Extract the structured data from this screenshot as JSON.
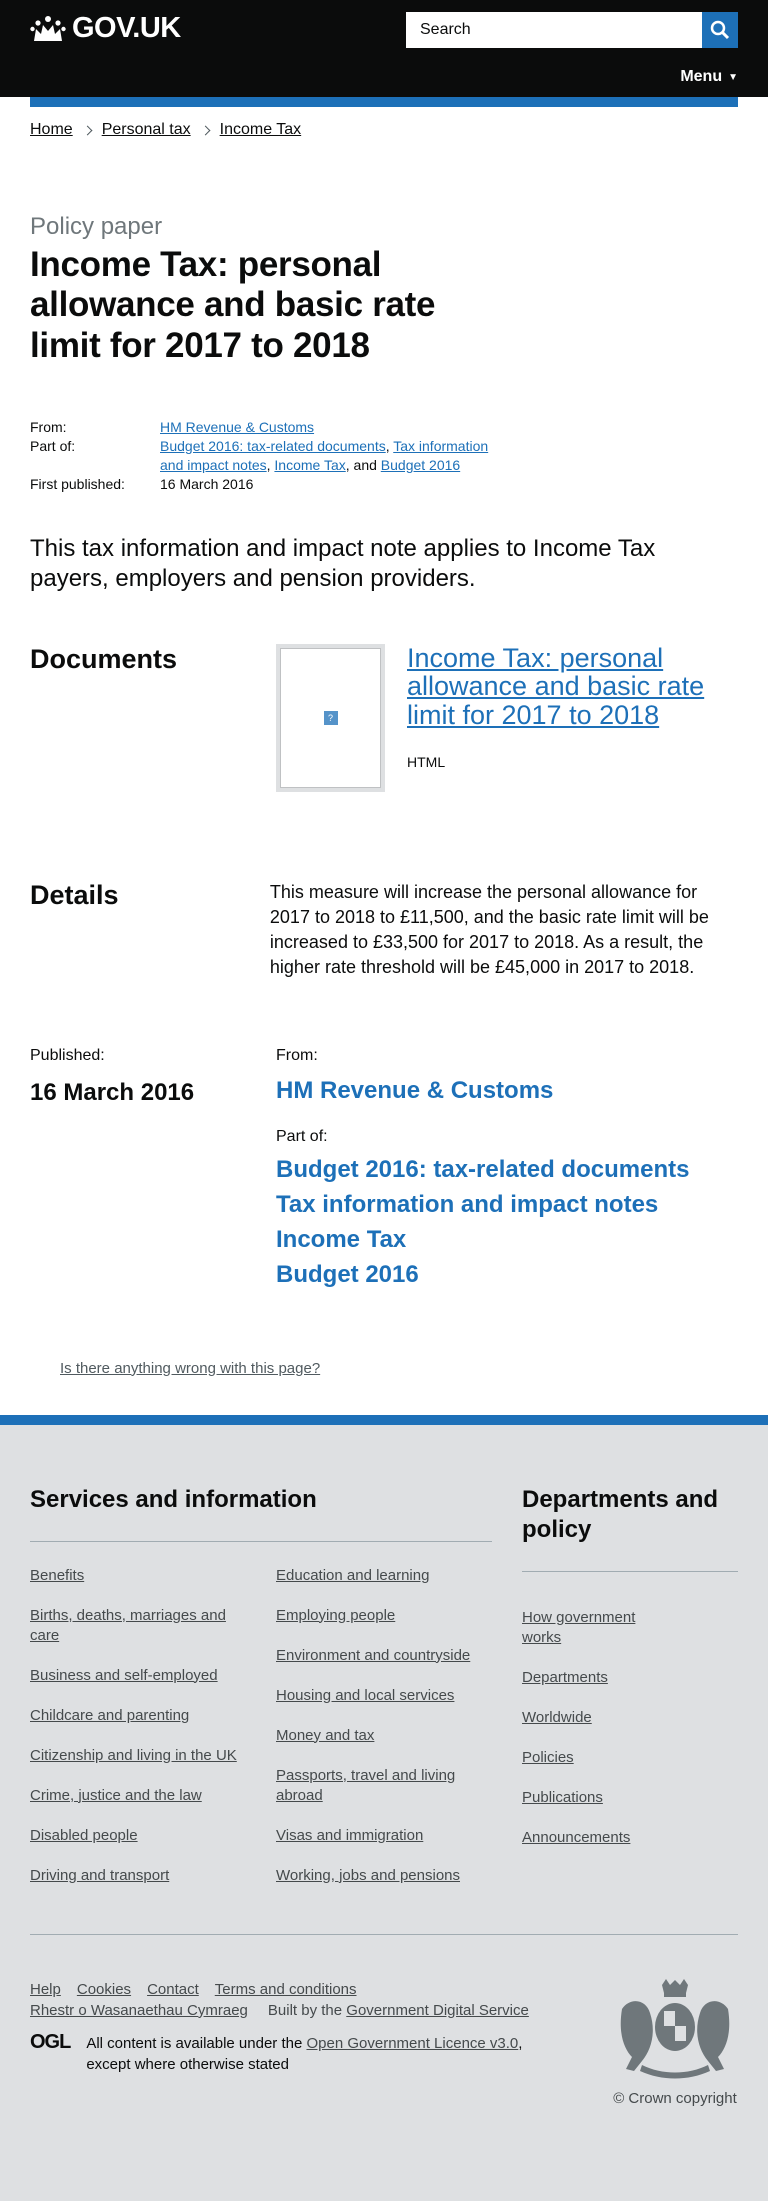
{
  "header": {
    "logo_text": "GOV.UK",
    "search_placeholder": "Search",
    "menu_label": "Menu",
    "menu_caret": "▼"
  },
  "breadcrumbs": [
    "Home",
    "Personal tax",
    "Income Tax"
  ],
  "page": {
    "caption": "Policy paper",
    "title": "Income Tax: personal allowance and basic rate limit for 2017 to 2018",
    "meta": {
      "from_label": "From:",
      "from_value": "HM Revenue & Customs",
      "partof_label": "Part of:",
      "partof_links": [
        "Budget 2016: tax-related documents",
        "Tax information and impact notes",
        "Income Tax",
        "Budget 2016"
      ],
      "sep_comma": ", ",
      "sep_and": ", and ",
      "published_label": "First published:",
      "published_value": "16 March 2016"
    },
    "lead": "This tax information and impact note applies to Income Tax payers, employers and pension providers.",
    "documents": {
      "heading": "Documents",
      "thumb_glyph": "?",
      "link": "Income Tax: personal allowance and basic rate limit for 2017 to 2018",
      "type": "HTML"
    },
    "details": {
      "heading": "Details",
      "text": "This measure will increase the personal allowance for 2017 to 2018 to £11,500, and the basic rate limit will be increased to £33,500 for 2017 to 2018. As a result, the higher rate threshold will be £45,000 in 2017 to 2018."
    },
    "published": {
      "label": "Published:",
      "date": "16 March 2016",
      "from_label": "From:",
      "from_link": "HM Revenue & Customs",
      "partof_label": "Part of:",
      "partof_links": [
        "Budget 2016: tax-related documents",
        "Tax information and impact notes",
        "Income Tax",
        "Budget 2016"
      ]
    },
    "report_link": "Is there anything wrong with this page?"
  },
  "footer": {
    "services_heading": "Services and information",
    "services_col1": [
      "Benefits",
      "Births, deaths, marriages and care",
      "Business and self-employed",
      "Childcare and parenting",
      "Citizenship and living in the UK",
      "Crime, justice and the law",
      "Disabled people",
      "Driving and transport"
    ],
    "services_col2": [
      "Education and learning",
      "Employing people",
      "Environment and countryside",
      "Housing and local services",
      "Money and tax",
      "Passports, travel and living abroad",
      "Visas and immigration",
      "Working, jobs and pensions"
    ],
    "depts_heading": "Departments and policy",
    "depts_links": [
      "How government works",
      "Departments",
      "Worldwide",
      "Policies",
      "Publications",
      "Announcements"
    ],
    "meta_links": [
      "Help",
      "Cookies",
      "Contact",
      "Terms and conditions"
    ],
    "welsh_link": "Rhestr o Wasanaethau Cymraeg",
    "built_by_prefix": "Built by the ",
    "built_by_link": "Government Digital Service",
    "ogl_logo": "OGL",
    "licence_prefix": "All content is available under the ",
    "licence_link": "Open Government Licence v3.0",
    "licence_suffix": ", except where otherwise stated",
    "copyright": "© Crown copyright"
  },
  "colors": {
    "brand_blue": "#1d70b8",
    "header_black": "#0b0c0c",
    "footer_grey": "#dee0e2"
  }
}
